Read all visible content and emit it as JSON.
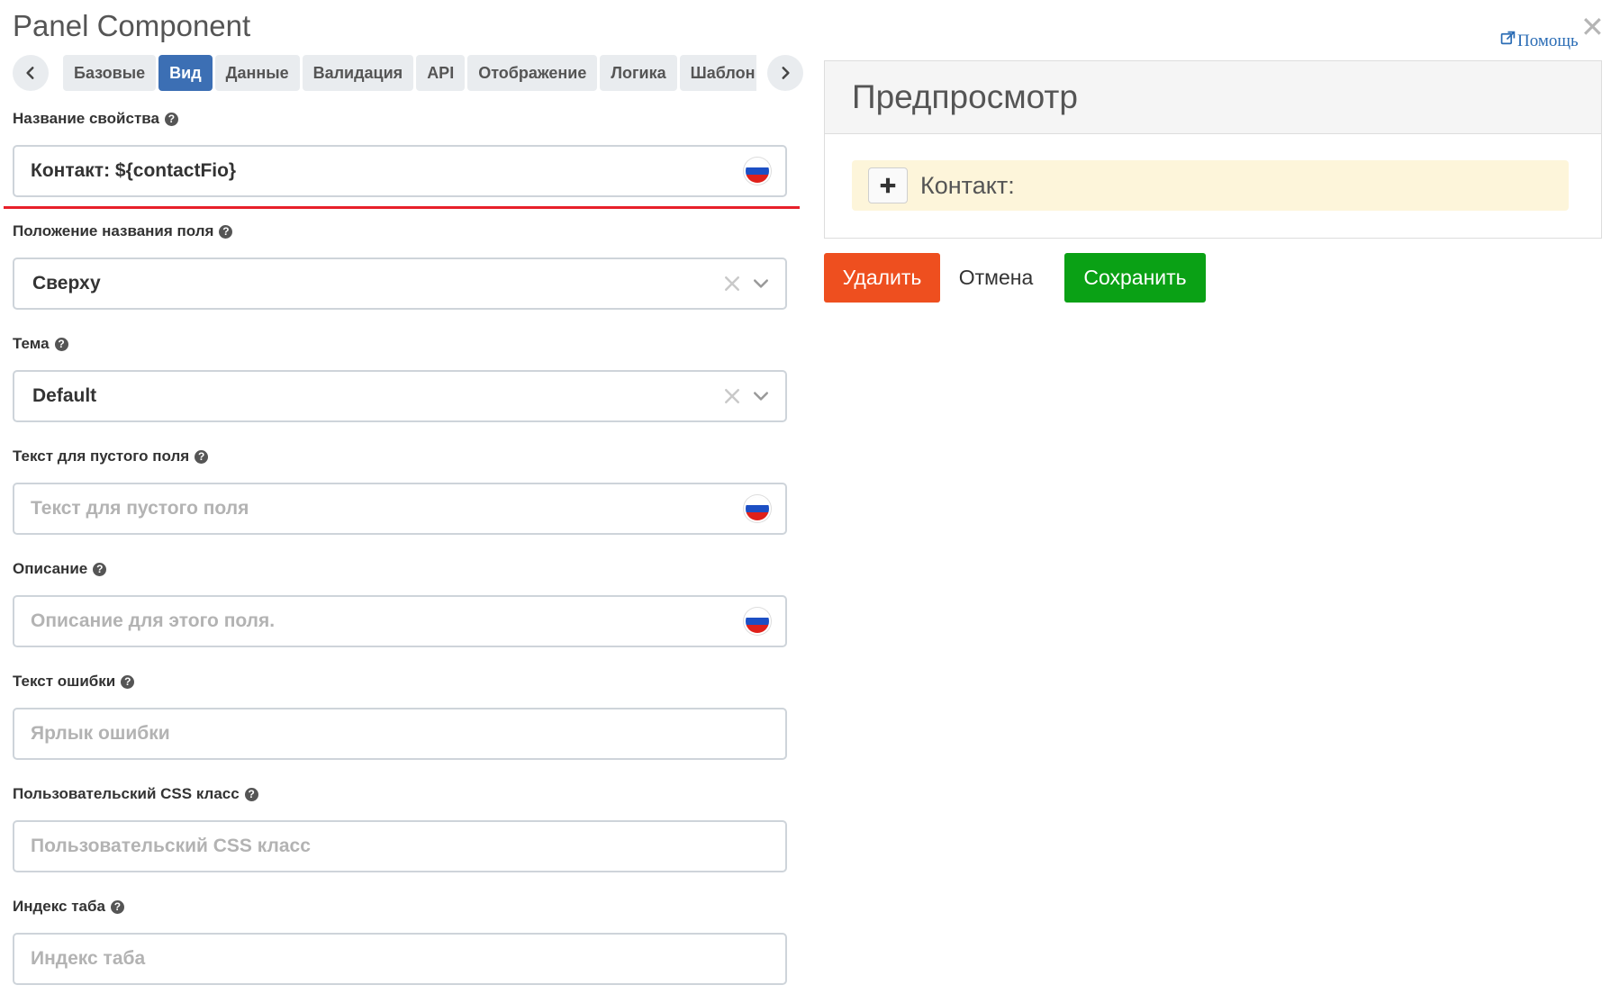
{
  "window": {
    "title": "Panel Component",
    "help_label": "Помощь",
    "close_glyph": "✕"
  },
  "tabs": [
    {
      "label": "Базовые",
      "active": false
    },
    {
      "label": "Вид",
      "active": true
    },
    {
      "label": "Данные",
      "active": false
    },
    {
      "label": "Валидация",
      "active": false
    },
    {
      "label": "API",
      "active": false
    },
    {
      "label": "Отображение",
      "active": false
    },
    {
      "label": "Логика",
      "active": false
    },
    {
      "label": "Шаблон",
      "active": false
    }
  ],
  "form": {
    "label_field": {
      "label": "Название свойства",
      "value": "Контакт: ${contactFio}"
    },
    "label_position": {
      "label": "Положение названия поля",
      "value": "Сверху"
    },
    "theme": {
      "label": "Тема",
      "value": "Default"
    },
    "placeholder": {
      "label": "Текст для пустого поля",
      "placeholder": "Текст для пустого поля"
    },
    "description": {
      "label": "Описание",
      "placeholder": "Описание для этого поля."
    },
    "error_label": {
      "label": "Текст ошибки",
      "placeholder": "Ярлык ошибки"
    },
    "custom_class": {
      "label": "Пользовательский CSS класс",
      "placeholder": "Пользовательский CSS класс"
    },
    "tab_index": {
      "label": "Индекс таба",
      "placeholder": "Индекс таба"
    }
  },
  "preview": {
    "heading": "Предпросмотр",
    "panel_title": "Контакт:"
  },
  "actions": {
    "delete": "Удалить",
    "cancel": "Отмена",
    "save": "Сохранить"
  },
  "colors": {
    "active_tab": "#3c6fb4",
    "delete_button": "#ee4f1f",
    "save_button": "#0aa115",
    "highlight_line": "#e8202a",
    "panel_background": "#fdf5da"
  },
  "icons": {
    "language_flag": "russian-flag-icon",
    "help": "question-circle-icon"
  }
}
